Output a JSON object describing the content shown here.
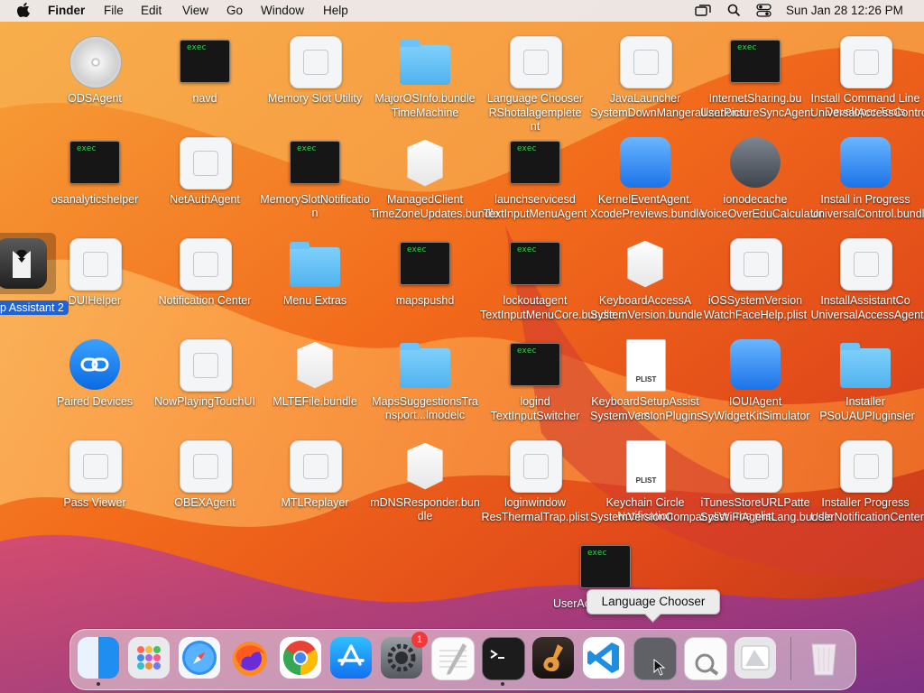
{
  "menubar": {
    "app_name": "Finder",
    "menus": [
      "File",
      "Edit",
      "View",
      "Go",
      "Window",
      "Help"
    ],
    "clock": "Sun Jan 28  12:26 PM",
    "status_icons": [
      "screen-mirroring-icon",
      "search-icon",
      "control-center-icon"
    ]
  },
  "desktop": {
    "icons": [
      {
        "label": "ODSAgent",
        "icon": "cd-disc-icon"
      },
      {
        "label": "navd",
        "icon": "exec-icon"
      },
      {
        "label": "Memory Slot Utility",
        "icon": "generic-app-icon"
      },
      {
        "label": "MajorOSInfo.bundle",
        "icon": "folder-icon"
      },
      {
        "label": "Language Chooser",
        "icon": "generic-app-icon"
      },
      {
        "label": "JavaLauncher",
        "icon": "generic-app-icon"
      },
      {
        "label": "InternetSharing.bu",
        "icon": "exec-icon"
      },
      {
        "label": "Install Command Line Developer Tools",
        "icon": "generic-app-icon"
      },
      {
        "label": "osanalyticshelper",
        "icon": "exec-icon"
      },
      {
        "label": "NetAuthAgent",
        "icon": "generic-app-icon"
      },
      {
        "label": "MemorySlotNotification",
        "icon": "exec-icon"
      },
      {
        "label": "ManagedClient",
        "icon": "bundle-icon"
      },
      {
        "label": "launchservicesd",
        "icon": "exec-icon"
      },
      {
        "label": "KernelEventAgent.",
        "icon": "blue-app-icon"
      },
      {
        "label": "ionodecache",
        "icon": "accessibility-icon"
      },
      {
        "label": "Install in Progress",
        "icon": "blue-app-icon"
      },
      {
        "label": "DUIHelper",
        "icon": "generic-app-icon"
      },
      {
        "label": "Notification Center",
        "icon": "generic-app-icon"
      },
      {
        "label": "Menu Extras",
        "icon": "folder-icon"
      },
      {
        "label": "mapspushd",
        "icon": "exec-icon"
      },
      {
        "label": "lockoutagent",
        "icon": "exec-icon"
      },
      {
        "label": "KeyboardAccessA",
        "icon": "bundle-icon"
      },
      {
        "label": "iOSSystemVersion",
        "icon": "generic-app-icon"
      },
      {
        "label": "InstallAssistantCo",
        "icon": "generic-app-icon"
      },
      {
        "label": "Paired Devices",
        "icon": "paired-devices-icon"
      },
      {
        "label": "NowPlayingTouchUI",
        "icon": "generic-app-icon"
      },
      {
        "label": "MLTEFile.bundle",
        "icon": "bundle-icon"
      },
      {
        "label": "MapsSuggestionsTransport...lmodelc",
        "icon": "folder-icon"
      },
      {
        "label": "logind",
        "icon": "exec-icon"
      },
      {
        "label": "KeyboardSetupAssistant",
        "icon": "plist-icon"
      },
      {
        "label": "IOUIAgent",
        "icon": "widget-icon"
      },
      {
        "label": "Installer",
        "icon": "folder-icon"
      },
      {
        "label": "Pass Viewer",
        "icon": "generic-app-icon"
      },
      {
        "label": "OBEXAgent",
        "icon": "generic-app-icon"
      },
      {
        "label": "MTLReplayer",
        "icon": "generic-app-icon"
      },
      {
        "label": "mDNSResponder.bundle",
        "icon": "bundle-icon"
      },
      {
        "label": "loginwindow",
        "icon": "generic-app-icon"
      },
      {
        "label": "Keychain Circle Notification",
        "icon": "plist-icon"
      },
      {
        "label": "iTunesStoreURLPatterns.plist",
        "icon": "generic-app-icon"
      },
      {
        "label": "Installer Progress",
        "icon": "generic-app-icon"
      },
      {
        "label": "UserAccountUpdater",
        "icon": "exec-icon"
      }
    ],
    "overlay_labels": [
      "TimeMachine",
      "RShotalagemplete",
      "nt",
      "SystemDownMangerallizations",
      "UserPictureSyncAgent",
      "UniversalAccessControl",
      "TimeZoneUpdates.bundle",
      "TextInputMenuAgent",
      "XcodePreviews.bundle",
      "VoiceOverEduCalculator",
      "UniversalControl.bundle",
      "TextInputMenuCore.bundle",
      "SystemVersion.bundle",
      "WatchFaceHelp.plist",
      "UniversalAccessAgent",
      "TextInputSwitcher",
      "SystemVersionPlugins",
      "SyWidgetKitSimulator",
      "PSoUAUPIuginsler",
      "ResThermalTrap.plist",
      "SystemVersionCompat.plist",
      "SysWiFiAgentLang.bundle",
      "UserNotificationCenter"
    ],
    "selected_item_label": "p Assistant 2"
  },
  "tooltip": "Language Chooser",
  "dock": {
    "apps": [
      {
        "name": "finder-icon",
        "running": true
      },
      {
        "name": "launchpad-icon",
        "running": false
      },
      {
        "name": "safari-icon",
        "running": false
      },
      {
        "name": "firefox-icon",
        "running": false
      },
      {
        "name": "chrome-icon",
        "running": false
      },
      {
        "name": "app-store-icon",
        "running": false
      },
      {
        "name": "system-settings-icon",
        "running": false,
        "badge": "1"
      },
      {
        "name": "textedit-icon",
        "running": false
      },
      {
        "name": "terminal-icon",
        "running": true
      },
      {
        "name": "garageband-icon",
        "running": false
      },
      {
        "name": "vscode-icon",
        "running": false
      },
      {
        "name": "language-chooser-icon",
        "running": false
      },
      {
        "name": "preview-icon",
        "running": false
      },
      {
        "name": "utility-icon",
        "running": false
      },
      {
        "name": "trash-icon",
        "running": false
      }
    ],
    "exec_text": "exec",
    "plist_text": "PLIST"
  }
}
